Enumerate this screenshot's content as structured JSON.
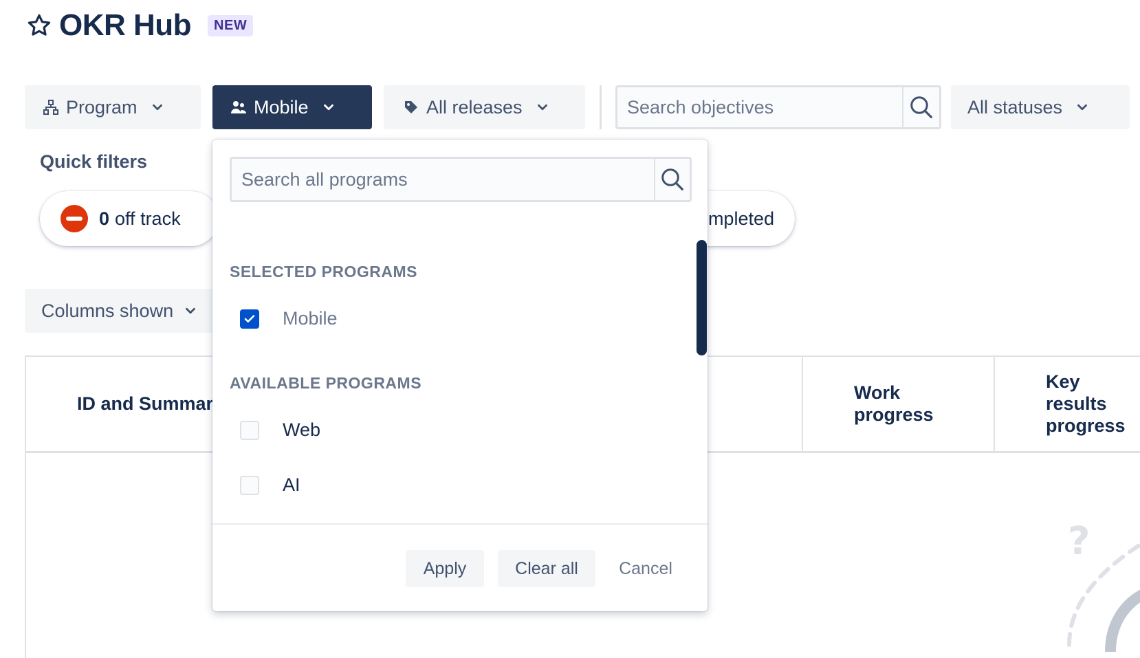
{
  "header": {
    "title": "OKR Hub",
    "badge": "NEW"
  },
  "toolbar": {
    "program_label": "Program",
    "mobile_label": "Mobile",
    "releases_label": "All releases",
    "search_placeholder": "Search objectives",
    "statuses_label": "All statuses"
  },
  "quick_filters": {
    "label": "Quick filters",
    "off_track_count": "0",
    "off_track_label": "off track",
    "completed_label_partial": "mpleted"
  },
  "columns_button": {
    "label": "Columns shown"
  },
  "table": {
    "headers": {
      "id_summary": "ID and Summar",
      "work_progress_1": "Work",
      "work_progress_2": "progress",
      "kr_progress_1": "Key",
      "kr_progress_2": "results",
      "kr_progress_3": "progress"
    }
  },
  "dropdown": {
    "search_placeholder": "Search all programs",
    "selected_heading": "SELECTED PROGRAMS",
    "selected": [
      {
        "label": "Mobile",
        "checked": true
      }
    ],
    "available_heading": "AVAILABLE PROGRAMS",
    "available": [
      {
        "label": "Web",
        "checked": false
      },
      {
        "label": "AI",
        "checked": false
      }
    ],
    "apply_label": "Apply",
    "clear_label": "Clear all",
    "cancel_label": "Cancel"
  },
  "colors": {
    "primary_dark": "#253858",
    "checkbox_checked": "#0052cc",
    "off_track": "#de350b",
    "badge_bg": "#eae6ff",
    "badge_text": "#403294"
  },
  "icons": {
    "star": "star-icon",
    "program": "hierarchy-icon",
    "mobile": "people-icon",
    "releases": "tag-icon",
    "search": "search-icon",
    "chevron": "chevron-down-icon"
  }
}
